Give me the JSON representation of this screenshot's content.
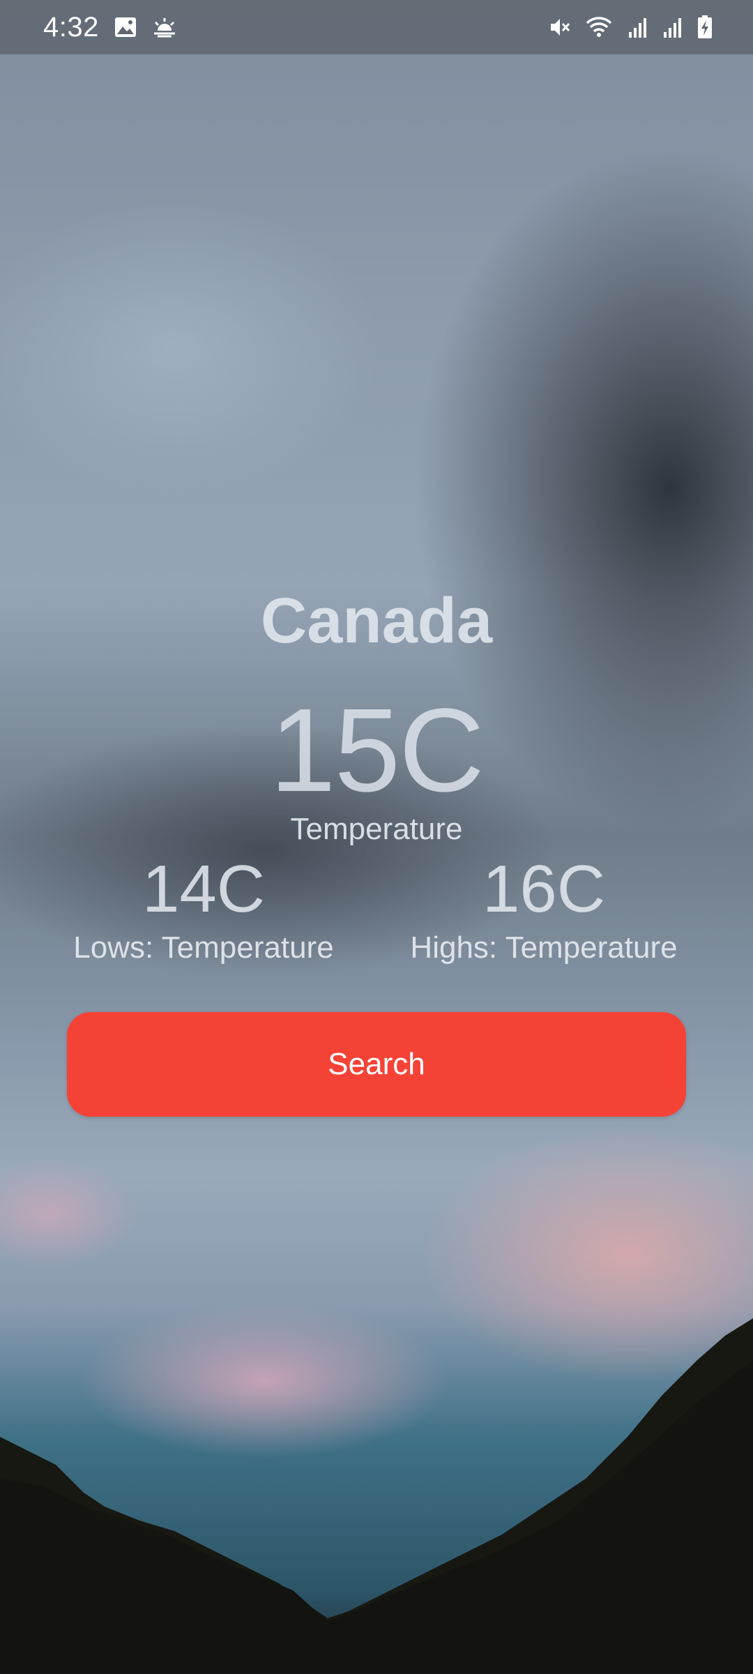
{
  "status_bar": {
    "time": "4:32",
    "left_icons": [
      "gallery-icon",
      "weather-icon"
    ],
    "right_icons": [
      "mute-icon",
      "wifi-icon",
      "signal-icon",
      "signal-icon",
      "battery-charging-icon"
    ]
  },
  "weather": {
    "city": "Canada",
    "temperature": "15C",
    "temperature_label": "Temperature",
    "low_value": "14C",
    "low_label": "Lows: Temperature",
    "high_value": "16C",
    "high_label": "Highs: Temperature"
  },
  "actions": {
    "search_label": "Search"
  },
  "colors": {
    "button": "#f44336"
  }
}
